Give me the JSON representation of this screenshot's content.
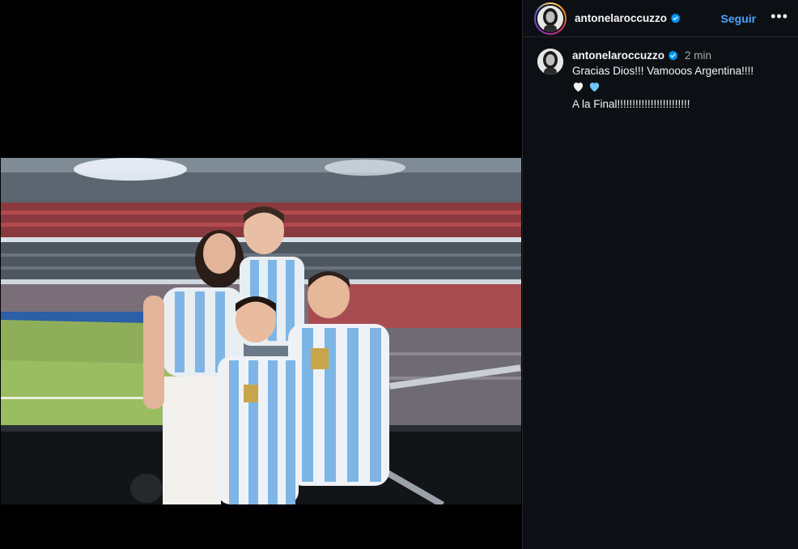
{
  "post": {
    "username": "antonelaroccuzzo",
    "follow_label": "Seguir",
    "more_label": "•••"
  },
  "caption": {
    "username": "antonelaroccuzzo",
    "time": "2 min",
    "line1": "Gracias Dios!!! Vamooos Argentina!!!!",
    "line3": "A la Final!!!!!!!!!!!!!!!!!!!!!!!!",
    "emojis": [
      "white-heart-icon",
      "light-blue-heart-icon"
    ]
  },
  "colors": {
    "sidebar_bg": "#0c1014",
    "accent_blue": "#4aa3ff",
    "verified_blue": "#0095f6",
    "muted_text": "#a8a8a8",
    "white_heart": "#f2f2f2",
    "blue_heart": "#6ec6ff"
  }
}
